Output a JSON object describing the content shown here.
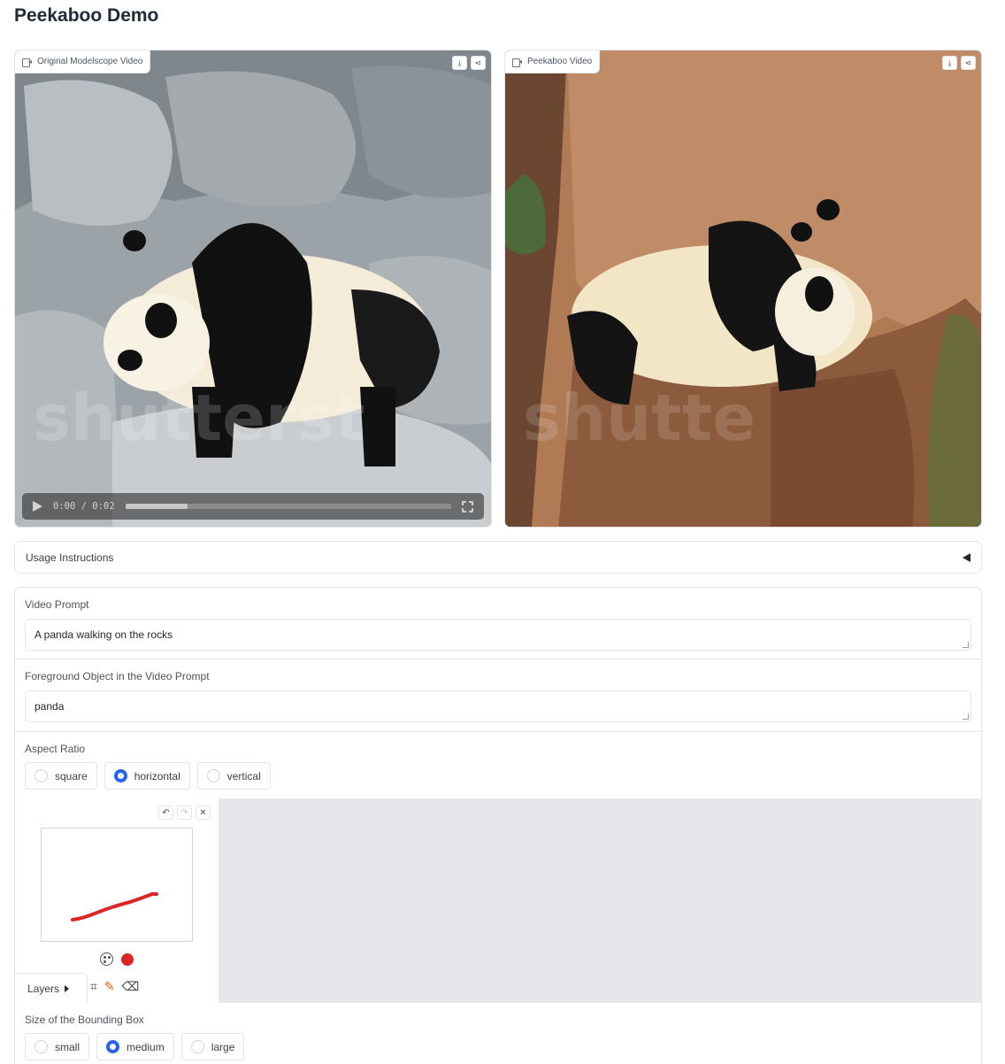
{
  "page": {
    "title": "Peekaboo Demo"
  },
  "videos": [
    {
      "label": "Original Modelscope Video",
      "download_icon": "download-icon",
      "share_icon": "share-icon",
      "current_time": "0:00",
      "duration": "0:02",
      "time_separator": "/",
      "progress_fraction": 0.19
    },
    {
      "label": "Peekaboo Video",
      "download_icon": "download-icon",
      "share_icon": "share-icon"
    }
  ],
  "accordion": {
    "label": "Usage Instructions",
    "state_icon": "collapse-arrow-icon"
  },
  "form": {
    "video_prompt": {
      "label": "Video Prompt",
      "value": "A panda walking on the rocks"
    },
    "foreground": {
      "label": "Foreground Object in the Video Prompt",
      "value": "panda"
    },
    "aspect_ratio": {
      "label": "Aspect Ratio",
      "options": [
        "square",
        "horizontal",
        "vertical"
      ],
      "selected": "horizontal"
    },
    "sketch": {
      "undo_icon": "undo-icon",
      "redo_icon": "redo-icon",
      "clear_icon": "close-icon",
      "palette_icon": "palette-icon",
      "brush_color": "#dc2626",
      "layers_label": "Layers",
      "crop_icon": "crop-icon",
      "brush_icon": "brush-icon",
      "eraser_icon": "eraser-icon"
    },
    "bbox_size": {
      "label": "Size of the Bounding Box",
      "options": [
        "small",
        "medium",
        "large"
      ],
      "selected": "medium"
    }
  },
  "colors": {
    "accent": "#2563eb",
    "border": "#e4e4e7",
    "sketch_bg": "#e5e7eb",
    "stroke": "#dc2626"
  }
}
